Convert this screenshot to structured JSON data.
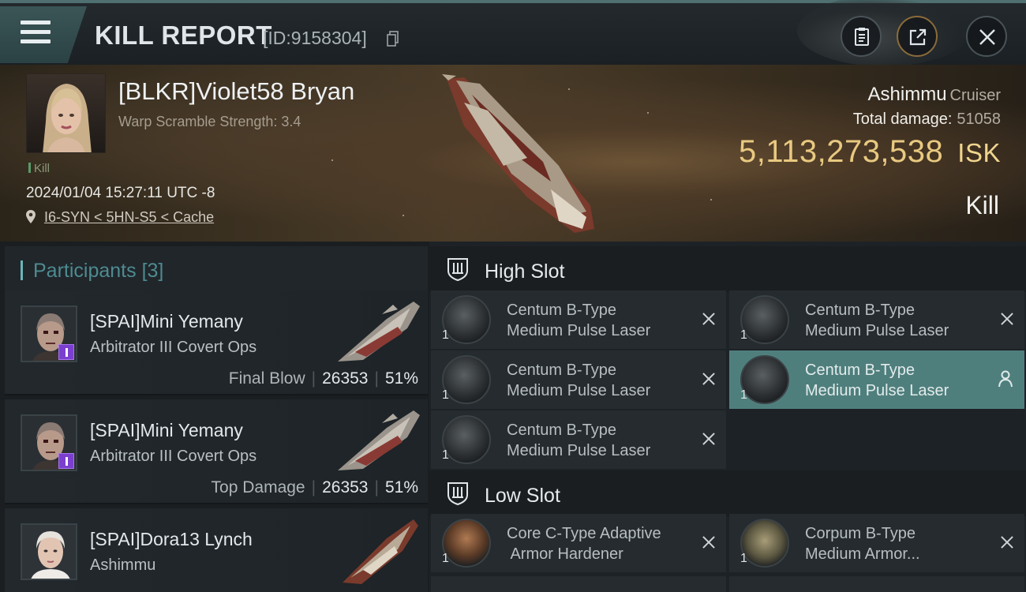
{
  "header": {
    "title": "KILL REPORT",
    "report_id": "[ID:9158304]",
    "icons": [
      "menu-icon",
      "copy-icon",
      "clipboard-icon",
      "share-icon",
      "close-icon"
    ]
  },
  "victim": {
    "name": "[BLKR]Violet58 Bryan",
    "warp_scramble": "Warp Scramble Strength: 3.4",
    "kill_tag": "Kill",
    "datetime": "2024/01/04 15:27:11 UTC -8",
    "location": "I6-SYN < 5HN-S5 < Cache",
    "ship_name": "Ashimmu",
    "ship_class": "Cruiser",
    "total_damage_label": "Total damage:",
    "total_damage_value": "51058",
    "isk_value": "5,113,273,538",
    "isk_unit": "ISK",
    "result": "Kill"
  },
  "participants": {
    "label": "Participants",
    "count": "[3]",
    "items": [
      {
        "name": "[SPAI]Mini Yemany",
        "ship": "Arbitrator III Covert Ops",
        "role": "Final Blow",
        "damage": "26353",
        "percent": "51%"
      },
      {
        "name": "[SPAI]Mini Yemany",
        "ship": "Arbitrator III Covert Ops",
        "role": "Top Damage",
        "damage": "26353",
        "percent": "51%"
      },
      {
        "name": "[SPAI]Dora13 Lynch",
        "ship": "Ashimmu",
        "role": "",
        "damage": "",
        "percent": ""
      }
    ]
  },
  "fitting": {
    "high_slot": {
      "label": "High Slot",
      "modules": [
        {
          "line1": "Centum B-Type",
          "line2": "Medium Pulse Laser",
          "qty": "1",
          "status": "destroyed"
        },
        {
          "line1": "Centum B-Type",
          "line2": "Medium Pulse Laser",
          "qty": "1",
          "status": "destroyed"
        },
        {
          "line1": "Centum B-Type",
          "line2": "Medium Pulse Laser",
          "qty": "1",
          "status": "destroyed"
        },
        {
          "line1": "Centum B-Type",
          "line2": "Medium Pulse Laser",
          "qty": "1",
          "status": "dropped"
        },
        {
          "line1": "Centum B-Type",
          "line2": "Medium Pulse Laser",
          "qty": "1",
          "status": "destroyed"
        }
      ]
    },
    "low_slot": {
      "label": "Low Slot",
      "modules": [
        {
          "line1": "Core C-Type Adaptive",
          "line2": " Armor Hardener",
          "qty": "1",
          "status": "destroyed"
        },
        {
          "line1": "Corpum B-Type",
          "line2": "Medium Armor...",
          "qty": "1",
          "status": "destroyed"
        }
      ]
    }
  },
  "colors": {
    "accent_teal": "#4e8b90",
    "isk_gold": "#e8c980",
    "active_module": "#4f7f7d",
    "badge_purple": "#7b3fd0"
  }
}
